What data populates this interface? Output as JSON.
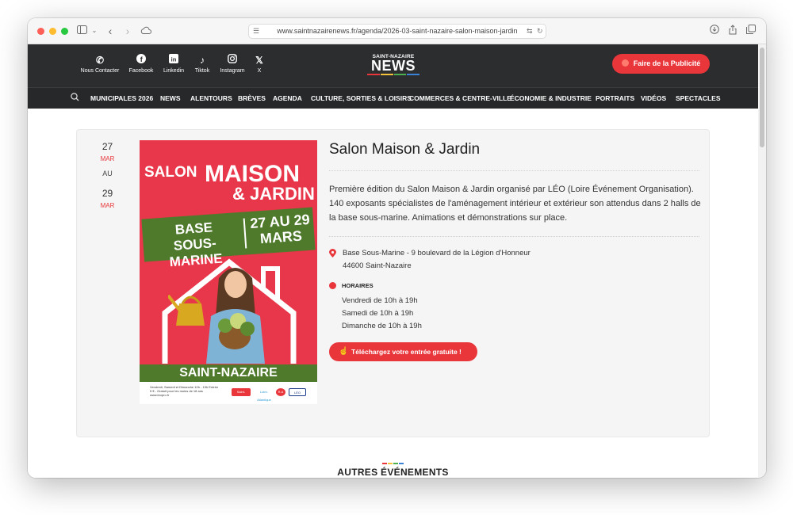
{
  "browser": {
    "url": "www.saintnazairenews.fr/agenda/2026-03-saint-nazaire-salon-maison-jardin"
  },
  "header": {
    "social": [
      {
        "label": "Nous Contacter",
        "icon": "phone-icon"
      },
      {
        "label": "Facebook",
        "icon": "facebook-icon"
      },
      {
        "label": "Linkedin",
        "icon": "linkedin-icon"
      },
      {
        "label": "Tiktok",
        "icon": "tiktok-icon"
      },
      {
        "label": "Instagram",
        "icon": "instagram-icon"
      },
      {
        "label": "X",
        "icon": "x-icon"
      }
    ],
    "logo_top": "SAINT-NAZAIRE",
    "logo_main": "NEWS",
    "logo_colors": [
      "#e8363b",
      "#f3c43b",
      "#4caf50",
      "#3b82d6"
    ],
    "pub_button": "Faire de la Publicité",
    "accent_color": "#e8363b"
  },
  "nav": {
    "items": [
      "MUNICIPALES 2026",
      "NEWS",
      "ALENTOURS",
      "BRÈVES",
      "AGENDA",
      "CULTURE, SORTIES & LOISIRS",
      "COMMERCES & CENTRE-VILLE",
      "ÉCONOMIE & INDUSTRIE",
      "PORTRAITS",
      "VIDÉOS",
      "SPECTACLES"
    ]
  },
  "event": {
    "start_day": "27",
    "start_month": "MAR",
    "au": "AU",
    "end_day": "29",
    "end_month": "MAR",
    "title": "Salon Maison & Jardin",
    "description": "Première édition du Salon Maison & Jardin organisé par LÉO (Loire Événement Organisation). 140 exposants spécialistes de l'aménagement intérieur et extérieur son attendus dans 2 halls de la base sous-marine. Animations et démonstrations sur place.",
    "address_line1": "Base Sous-Marine - 9 boulevard de la Légion d'Honneur",
    "address_line2": "44600 Saint-Nazaire",
    "hours_label": "HORAIRES",
    "hours": [
      "Vendredi de 10h à 19h",
      "Samedi de 10h à 19h",
      "Dimanche de 10h à 19h"
    ],
    "download_button": "Téléchargez votre entrée gratuite !"
  },
  "poster": {
    "salon": "SALON",
    "maison": "MAISON",
    "jardin": "& JARDIN",
    "base_line1": "BASE",
    "base_line2": "SOUS-MARINE",
    "dates_line1": "27 AU 29",
    "dates_line2": "MARS",
    "city": "SAINT-NAZAIRE",
    "small_text": "Vendredi, Samedi et Dimanche 10h - 19h Entrée 5 € - Gratuit pour les moins de 18 ans www.leopro.fr",
    "sponsors": [
      "Saint-Nazaire",
      "Loire-Atlantique",
      "R.A",
      "LÉO"
    ]
  },
  "others_title": "AUTRES ÉVÉNEMENTS"
}
